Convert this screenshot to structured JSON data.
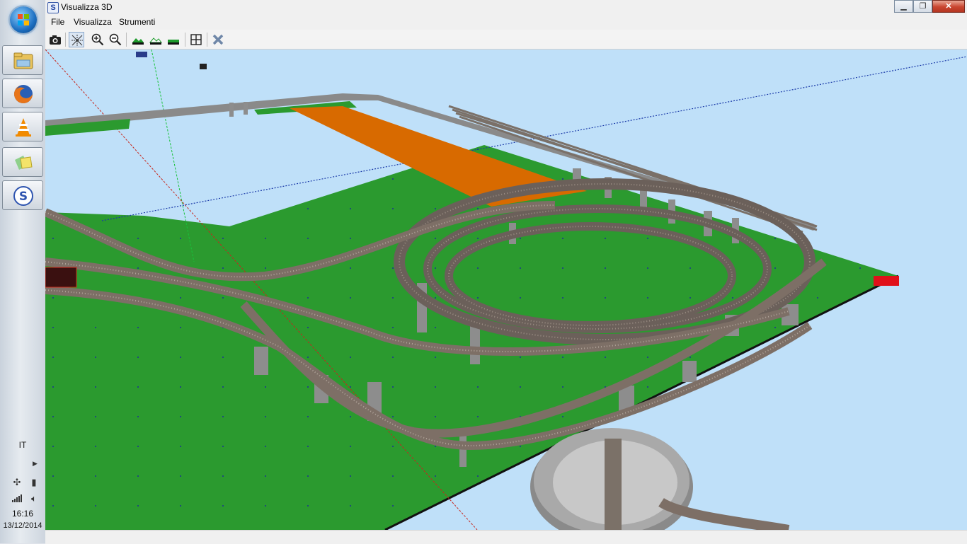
{
  "window": {
    "title": "Visualizza 3D",
    "app_icon_letter": "S"
  },
  "menu": {
    "items": [
      "File",
      "Visualizza",
      "Strumenti"
    ]
  },
  "toolbar": {
    "tools": [
      {
        "name": "camera-icon"
      },
      {
        "name": "axes-toggle-icon",
        "pressed": true
      },
      {
        "name": "zoom-in-icon"
      },
      {
        "name": "zoom-out-icon"
      },
      {
        "name": "terrain-view-1-icon"
      },
      {
        "name": "terrain-view-2-icon"
      },
      {
        "name": "terrain-flat-icon"
      },
      {
        "name": "fit-view-icon"
      },
      {
        "name": "close-view-icon"
      }
    ]
  },
  "taskbar": {
    "pinned": [
      "explorer-icon",
      "firefox-icon",
      "vlc-icon",
      "photos-icon",
      "app-s-icon"
    ],
    "language": "IT",
    "time": "16:16",
    "date": "13/12/2014"
  },
  "scene": {
    "sky_color": "#bfe0f9",
    "baseboard_color": "#2b9a2f",
    "track_color": "#7d6f66",
    "platform_color": "#d86a00",
    "pillar_color": "#8d8d8d"
  }
}
